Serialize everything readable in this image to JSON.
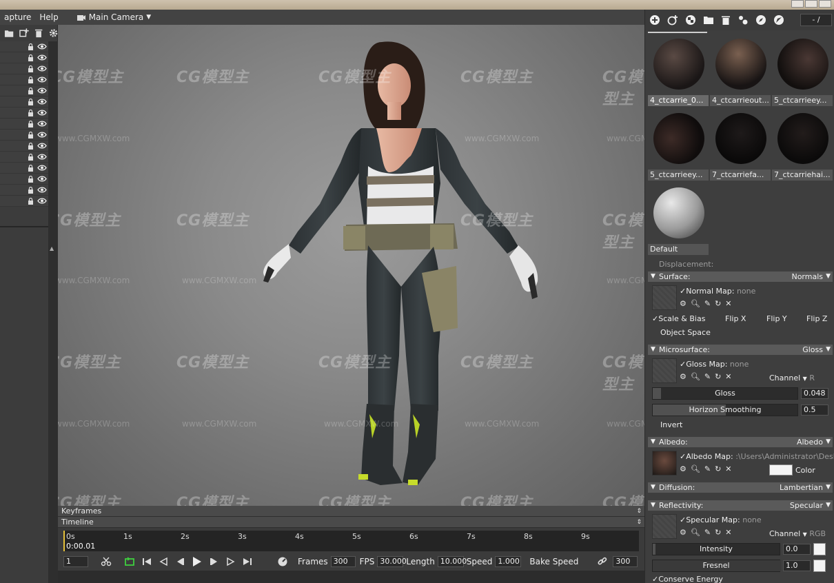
{
  "menu": {
    "items": [
      "apture",
      "Help"
    ],
    "camera": "Main Camera"
  },
  "viewport": {
    "watermark": "CG模型主",
    "watermark_url": "www.CGMXW.com"
  },
  "timeline": {
    "keyframes_label": "Keyframes",
    "timeline_label": "Timeline",
    "ticks": [
      "0s",
      "1s",
      "2s",
      "3s",
      "4s",
      "5s",
      "6s",
      "7s",
      "8s",
      "9s"
    ],
    "current_time": "0:00.01",
    "frame": "1",
    "frames_label": "Frames",
    "frames": "300",
    "fps_label": "FPS",
    "fps": "30.000",
    "length_label": "Length",
    "length": "10.000",
    "speed_label": "Speed",
    "speed": "1.000",
    "bake_speed_label": "Bake Speed",
    "bake_value": "300"
  },
  "materials": {
    "counter": "- /",
    "items": [
      {
        "label": "4_ctcarrie_0...",
        "selected": true
      },
      {
        "label": "4_ctcarrieout..."
      },
      {
        "label": "5_ctcarrieey..."
      },
      {
        "label": "5_ctcarrieey..."
      },
      {
        "label": "7_ctcarriefa..."
      },
      {
        "label": "7_ctcarriehai..."
      },
      {
        "label": "Default"
      }
    ]
  },
  "props": {
    "displacement_label": "Displacement:",
    "surface": {
      "title": "Surface:",
      "mode": "Normals",
      "normal_map_label": "Normal Map:",
      "normal_map_value": "none",
      "scale_bias": "Scale & Bias",
      "flip_x": "Flip X",
      "flip_y": "Flip Y",
      "flip_z": "Flip Z",
      "object_space": "Object Space"
    },
    "microsurface": {
      "title": "Microsurface:",
      "mode": "Gloss",
      "gloss_map_label": "Gloss Map:",
      "gloss_map_value": "none",
      "channel_label": "Channel",
      "channel_value": "R",
      "gloss_label": "Gloss",
      "gloss_value": "0.048",
      "horizon_label": "Horizon Smoothing",
      "horizon_value": "0.5",
      "invert": "Invert"
    },
    "albedo": {
      "title": "Albedo:",
      "mode": "Albedo",
      "albedo_map_label": "Albedo Map:",
      "albedo_map_value": ":\\Users\\Administrator\\Desk",
      "color_label": "Color"
    },
    "diffusion": {
      "title": "Diffusion:",
      "mode": "Lambertian"
    },
    "reflectivity": {
      "title": "Reflectivity:",
      "mode": "Specular",
      "specular_map_label": "Specular Map:",
      "specular_map_value": "none",
      "channel_label": "Channel",
      "channel_value": "RGB",
      "intensity_label": "Intensity",
      "intensity_value": "0.0",
      "fresnel_label": "Fresnel",
      "fresnel_value": "1.0",
      "conserve_energy": "Conserve Energy"
    }
  }
}
